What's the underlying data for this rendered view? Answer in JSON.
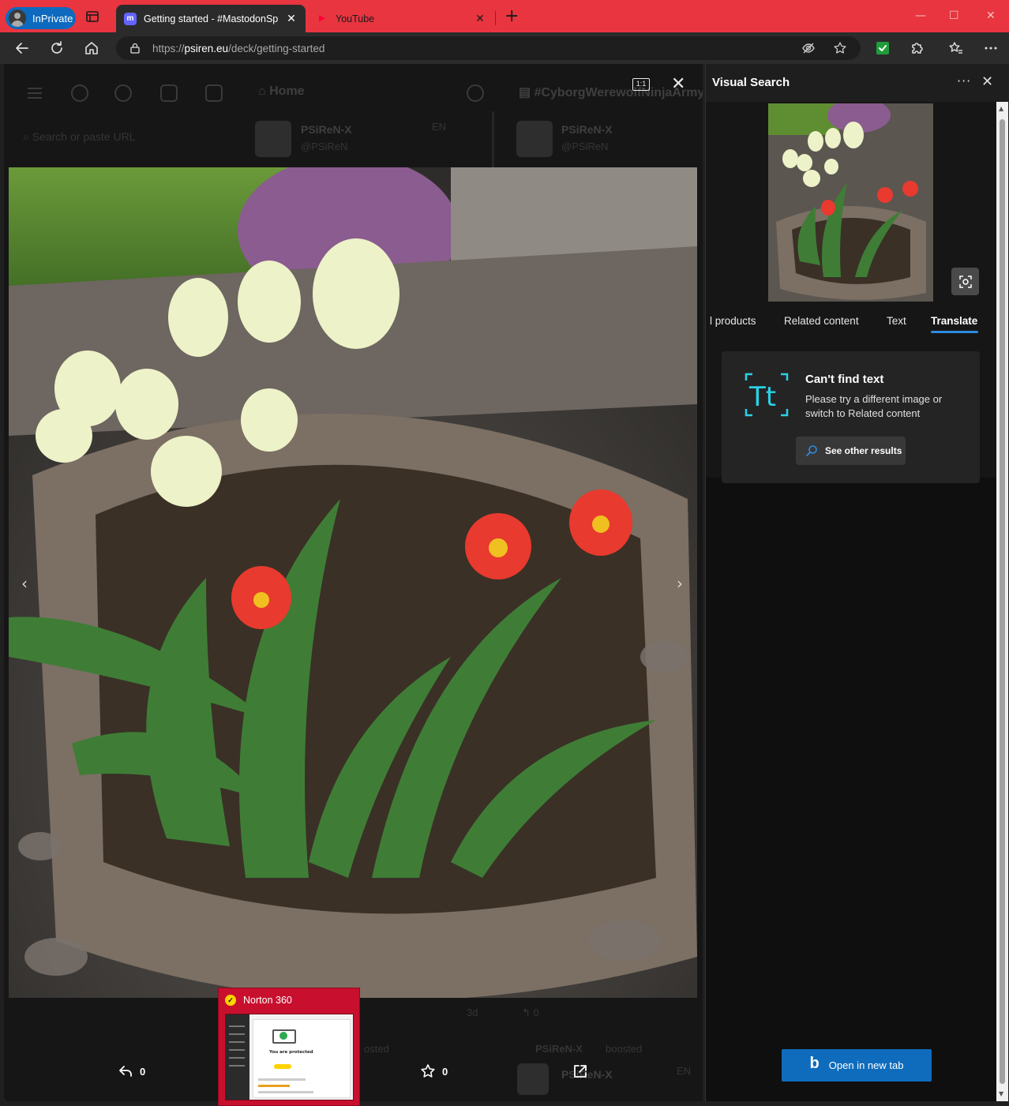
{
  "browser": {
    "inprivate_label": "InPrivate",
    "tabs": [
      {
        "title": "Getting started - #MastodonSpyB",
        "favicon": "mastodon-icon",
        "active": true
      },
      {
        "title": "YouTube",
        "favicon": "youtube-icon",
        "active": false
      }
    ],
    "new_tab": "+",
    "window_controls": {
      "minimize": "—",
      "maximize": "☐",
      "close": "✕"
    },
    "url_prefix": "https://",
    "url_domain": "psiren.eu",
    "url_path": "/deck/getting-started"
  },
  "page": {
    "background": {
      "home_label": "Home",
      "column_title": "#CyborgWerewolfNinjaArmy",
      "search_placeholder": "Search or paste URL",
      "account_name": "PSiReN-X",
      "account_handle": "@PSiReN",
      "lang": "EN",
      "timestamp": "3d",
      "boosted_name": "PSiReN-X",
      "boosted_label": "boosted",
      "partial_boosted": "osted",
      "reply_count_bg": "0"
    },
    "lightbox": {
      "one_to_one": "1:1",
      "close": "✕",
      "prev": "‹",
      "next": "›",
      "reply_count": "0",
      "favourite_count": "0"
    },
    "norton_popup": {
      "title": "Norton 360",
      "thumb_text": "You are protected"
    }
  },
  "visual_search": {
    "title": "Visual Search",
    "more": "···",
    "close": "✕",
    "tabs": [
      "l products",
      "Related content",
      "Text",
      "Translate"
    ],
    "selected_tab": "Translate",
    "card": {
      "title": "Can't find text",
      "message": "Please try a different image or switch to Related content",
      "button": "See other results"
    },
    "open_button": "Open in new tab",
    "colors": {
      "accent": "#0f6cbd",
      "teal_icon": "#2ad1e8"
    }
  }
}
